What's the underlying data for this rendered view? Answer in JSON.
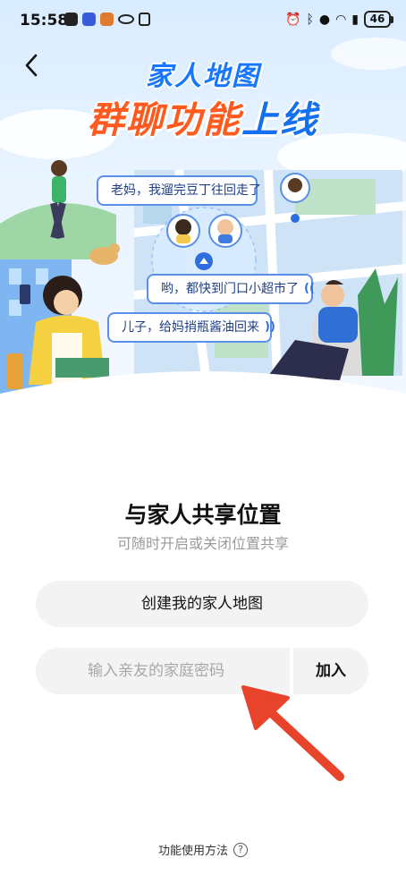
{
  "status_bar": {
    "time": "15:58",
    "battery": "46",
    "left_icons": [
      "camera-app-icon",
      "bluetooth-app-icon",
      "orange-app-icon",
      "eye-icon",
      "nfc-icon"
    ],
    "right_icons": [
      "alarm-icon",
      "bluetooth-icon",
      "location-icon",
      "wifi-icon",
      "signal-icon",
      "battery-icon"
    ]
  },
  "hero": {
    "title_line1": "家人地图",
    "title_line2_part1": "群聊功能",
    "title_line2_part2": "上线",
    "bubbles": [
      {
        "text": "老妈，我遛完豆丁往回走了"
      },
      {
        "text": "哟，都快到门口小超市了"
      },
      {
        "text": "儿子，给妈捎瓶酱油回来"
      }
    ],
    "colors": {
      "title_blue": "#1877ff",
      "title_orange": "#ff5a1f",
      "bubble_border": "#5a8fe8"
    }
  },
  "main": {
    "title": "与家人共享位置",
    "subtitle": "可随时开启或关闭位置共享",
    "create_button_label": "创建我的家人地图",
    "join_input_placeholder": "输入亲友的家庭密码",
    "join_input_value": "",
    "join_button_label": "加入",
    "help_link_label": "功能使用方法",
    "help_icon": "?"
  },
  "colors": {
    "accent_arrow": "#e8432b",
    "button_bg": "#f3f3f3"
  }
}
